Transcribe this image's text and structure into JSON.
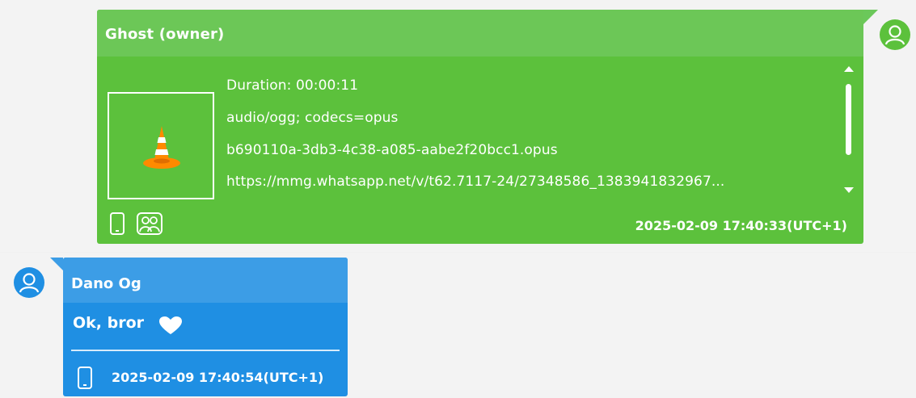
{
  "messages": [
    {
      "sender": "Ghost (owner)",
      "attachment": {
        "thumbnail_icon": "vlc-cone-icon",
        "duration": "Duration: 00:00:11",
        "mime": "audio/ogg; codecs=opus",
        "filename": "b690110a-3db3-4c38-a085-aabe2f20bcc1.opus",
        "url": "https://mmg.whatsapp.net/v/t62.7117-24/27348586_1383941832967..."
      },
      "footer_icons": [
        "phone-icon",
        "group-icon"
      ],
      "timestamp": "2025-02-09 17:40:33(UTC+1)",
      "colors": {
        "bubble": "#5cc13c",
        "header": "#6cc757",
        "avatar": "#5cc13c"
      }
    },
    {
      "sender": "Dano Og",
      "text": "Ok, bror",
      "emoji_icon": "heart-icon",
      "footer_icons": [
        "phone-icon"
      ],
      "timestamp": "2025-02-09 17:40:54(UTC+1)",
      "colors": {
        "bubble": "#1f8fe3",
        "header": "#3c9de6",
        "avatar": "#1f8fe3"
      }
    }
  ]
}
